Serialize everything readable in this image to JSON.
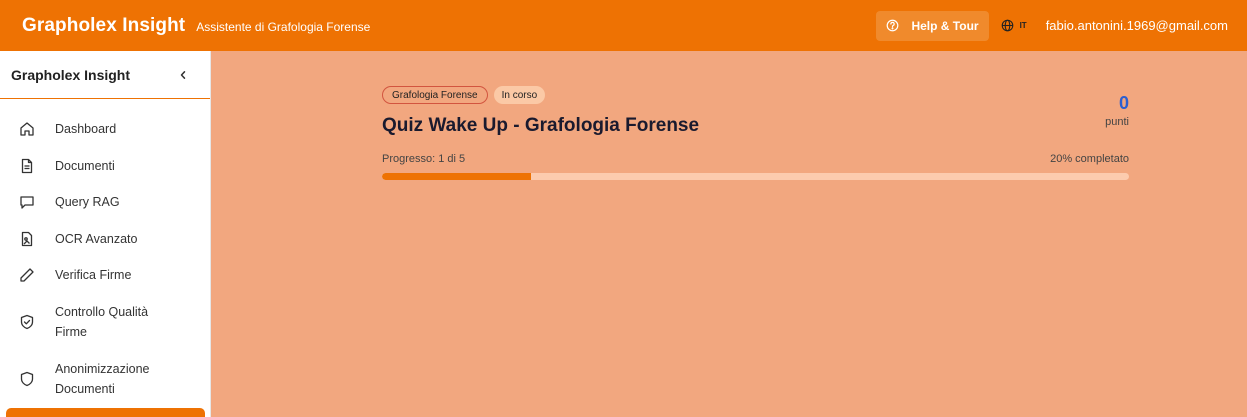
{
  "header": {
    "brand": "Grapholex Insight",
    "tagline": "Assistente di Grafologia Forense",
    "help_label": "Help & Tour",
    "help_icon": "question-circle-icon",
    "language_code": "IT",
    "language_icon": "globe-icon",
    "user_email": "fabio.antonini.1969@gmail.com"
  },
  "sidebar": {
    "title": "Grapholex Insight",
    "collapse_icon": "chevron-left-icon",
    "items": [
      {
        "label": "Dashboard",
        "icon": "home-icon"
      },
      {
        "label": "Documenti",
        "icon": "document-icon"
      },
      {
        "label": "Query RAG",
        "icon": "chat-bubble-icon"
      },
      {
        "label": "OCR Avanzato",
        "icon": "scan-image-icon"
      },
      {
        "label": "Verifica Firme",
        "icon": "pen-icon"
      },
      {
        "label": "Controllo Qualità Firme",
        "icon": "shield-check-icon"
      },
      {
        "label": "Anonimizzazione Documenti",
        "icon": "shield-icon"
      }
    ]
  },
  "quiz": {
    "category_badge": "Grafologia Forense",
    "status_badge": "In corso",
    "title": "Quiz Wake Up - Grafologia Forense",
    "score_value": "0",
    "score_label": "punti",
    "progress_text": "Progresso: 1 di 5",
    "progress_percent_text": "20% completato",
    "progress_fraction": 0.2
  },
  "colors": {
    "accent": "#ee7203",
    "page_background": "#f2a77f",
    "score": "#2c5fd0"
  }
}
